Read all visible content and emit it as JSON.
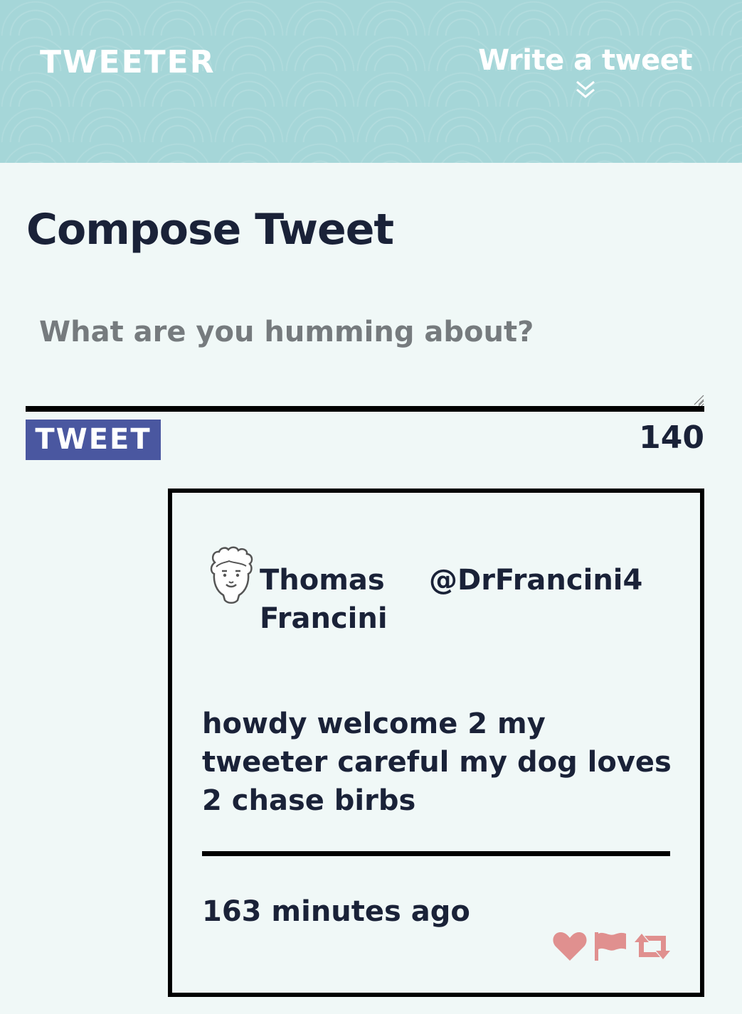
{
  "header": {
    "brand": "TWEETER",
    "write_tweet_label": "Write a tweet",
    "chevron_icon": "chevrons-down-icon",
    "background_color": "#a5d6d8"
  },
  "compose": {
    "title": "Compose Tweet",
    "placeholder": "What are you humming about?",
    "value": "",
    "button_label": "TWEET",
    "button_color": "#4a57a0",
    "char_counter": "140"
  },
  "tweets": [
    {
      "avatar_icon": "face-avatar-icon",
      "display_name": "Thomas Francini",
      "handle": "@DrFrancini4",
      "text": "howdy welcome 2 my tweeter careful my dog loves 2 chase birbs",
      "timestamp": "163 minutes ago",
      "actions": [
        {
          "icon": "heart-icon",
          "color": "#e0908f"
        },
        {
          "icon": "flag-icon",
          "color": "#e0908f"
        },
        {
          "icon": "retweet-icon",
          "color": "#e0908f"
        }
      ]
    }
  ]
}
